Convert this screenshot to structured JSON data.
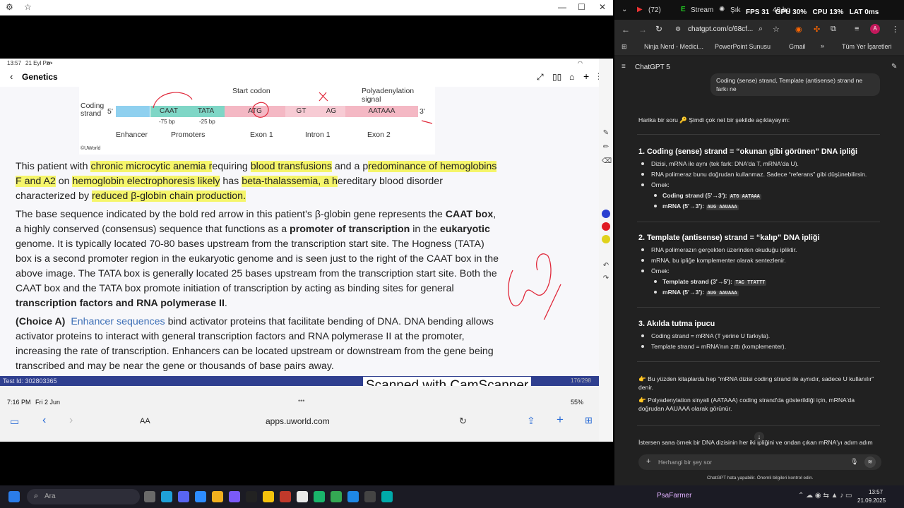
{
  "left_window": {
    "ipad_status": {
      "time": "13:57",
      "date": "21 Eyl Pzr"
    },
    "app_header": {
      "title": "Genetics"
    },
    "diagram": {
      "coding_strand_label": "Coding strand",
      "five_prime": "5'",
      "three_prime": "3'",
      "start_codon": "Start codon",
      "polyA_signal": "Polyadenylation signal",
      "segments": [
        "CAAT",
        "TATA",
        "ATG",
        "GT",
        "AG",
        "AATAAA"
      ],
      "sub_labels": [
        "-75 bp",
        "-25 bp"
      ],
      "regions": [
        "Enhancer",
        "Promoters",
        "Exon 1",
        "Intron 1",
        "Exon 2"
      ],
      "copyright": "©UWorld"
    },
    "para1_a": "This patient with ",
    "para1_hl1": "chronic microcytic anemia r",
    "para1_b": "equiring ",
    "para1_hl2": "blood transfusions",
    "para1_c": " and a p",
    "para1_hl3": "redominance of hemoglobins F and A2",
    "para1_d": " on ",
    "para1_hl4": "hemoglobin electrophoresis likely",
    "para1_e": " has ",
    "para1_hl5": "beta-thalassemia, a h",
    "para1_f": "ereditary blood disorder characterized by ",
    "para1_hl6": "reduced β-globin chain production.",
    "para2_a": "The base sequence indicated by the bold red arrow in this patient's β-globin gene represents the ",
    "para2_b1": "CAAT box",
    "para2_c": ", a highly conserved (consensus) sequence that functions as a ",
    "para2_b2": "promoter of transcription",
    "para2_d": " in the ",
    "para2_b3": "eukaryotic",
    "para2_e": " genome.  It is typically located 70-80 bases upstream from the transcription start site.  The Hogness (TATA) box is a second promoter region in the eukaryotic genome and is seen just to the right of the CAAT box in the above image.  The TATA box is generally located 25 bases upstream from the transcription start site.  Both the CAAT box and the TATA box promote initiation of transcription by acting as binding sites for general ",
    "para2_b4": "transcription factors and RNA polymerase II",
    "para2_f": ".",
    "para3_choice": "(Choice A)",
    "para3_link": "Enhancer sequences",
    "para3_text": " bind activator proteins that facilitate bending of DNA.  DNA bending allows activator proteins to interact with general transcription factors and RNA polymerase II at the promoter, increasing the rate of transcription.  Enhancers can be located upstream or downstream from the gene being transcribed and may be near the gene or thousands of base pairs away.",
    "test_id": "Test Id: 302803365",
    "page_count": "176/298",
    "camscanner": "Scanned with CamScanner",
    "safari": {
      "time": "7:16 PM",
      "date": "Fri 2 Jun",
      "battery": "55%",
      "aa": "AA",
      "url": "apps.uworld.com"
    }
  },
  "right_window": {
    "tabs": [
      "(72)",
      "Stream",
      "Şık",
      "40 ho"
    ],
    "overlay": {
      "fps": "FPS",
      "fps_val": "31",
      "gpu": "GPU",
      "gpu_val": "30%",
      "cpu": "CPU",
      "cpu_val": "13%",
      "lat": "LAT",
      "lat_val": "0ms"
    },
    "url": "chatgpt.com/c/68cf...",
    "bookmarks": [
      "Ninja Nerd - Medici...",
      "PowerPoint Sunusu",
      "Gmail",
      "Tüm Yer İşaretleri"
    ],
    "model": "ChatGPT 5",
    "user_msg": "Coding (sense) strand, Template (antisense) strand ne farkı ne",
    "intro": "Harika bir soru 🔑 Şimdi çok net bir şekilde açıklayayım:",
    "s1_title": "1. Coding (sense) strand = “okunan gibi görünen” DNA ipliği",
    "s1_b1": "Dizisi, mRNA ile aynı (tek fark: DNA'da T, mRNA'da U).",
    "s1_b2": "RNA polimeraz bunu doğrudan kullanmaz. Sadece “referans” gibi düşünebilirsin.",
    "s1_b3": "Örnek:",
    "s1_e1": "Coding strand (5'→3'):",
    "s1_e1c": "ATG AATAAA",
    "s1_e2": "mRNA (5'→3'):",
    "s1_e2c": "AUG AAUAAA",
    "s2_title": "2. Template (antisense) strand = “kalıp” DNA ipliği",
    "s2_b1": "RNA polimerazın gerçekten üzerinden okuduğu ipliktir.",
    "s2_b2": "mRNA, bu ipliğe komplementer olarak sentezlenir.",
    "s2_b3": "Örnek:",
    "s2_e1": "Template strand (3'→5'):",
    "s2_e1c": "TAC TTATTT",
    "s2_e2": "mRNA (5'→3'):",
    "s2_e2c": "AUG AAUAAA",
    "s3_title": "3. Akılda tutma ipucu",
    "s3_b1": "Coding strand = mRNA (T yerine U farkıyla).",
    "s3_b2": "Template strand = mRNA'nın zıttı (komplementer).",
    "p1": "👉 Bu yüzden kitaplarda hep “mRNA dizisi coding strand ile aynıdır, sadece U kullanılır” denir.",
    "p2": "👉 Polyadenylation sinyali (AATAAA) coding strand'da gösterildiği için, mRNA'da doğrudan AAUAAA olarak görünür.",
    "p3": "İstersen sana örnek bir DNA dizisinin her iki ipliğini ve ondan çıkan mRNA'yı adım adım çizilmiş şekilde göstereyim mi?",
    "input_placeholder": "Herhangi bir şey sor",
    "disclaimer": "ChatGPT hata yapabilir. Önemli bilgileri kontrol edin."
  },
  "taskbar": {
    "search": "Ara",
    "user": "PsaFarmer",
    "time": "13:57",
    "date": "21.09.2025"
  }
}
